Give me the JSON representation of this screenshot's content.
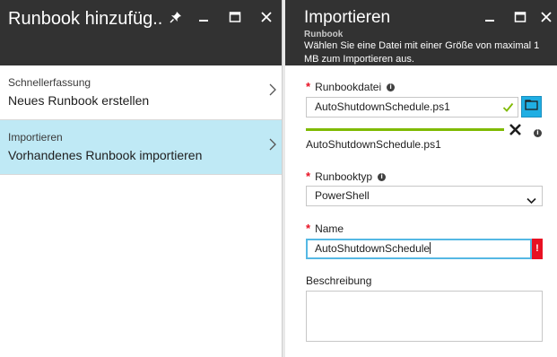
{
  "left_blade": {
    "title": "Runbook hinzufüg...",
    "items": [
      {
        "sublabel": "Schnellerfassung",
        "label": "Neues Runbook erstellen",
        "selected": false
      },
      {
        "sublabel": "Importieren",
        "label": "Vorhandenes Runbook importieren",
        "selected": true
      }
    ]
  },
  "right_blade": {
    "title": "Importieren",
    "subtitle": "Runbook",
    "description": "Wählen Sie eine Datei mit einer Größe von maximal 1 MB zum Importieren aus.",
    "file_field": {
      "label": "Runbookdatei",
      "value": "AutoShutdownSchedule.ps1",
      "upload_progress": 1.0,
      "uploaded_file_name": "AutoShutdownSchedule.ps1"
    },
    "type_field": {
      "label": "Runbooktyp",
      "value": "PowerShell"
    },
    "name_field": {
      "label": "Name",
      "value": "AutoShutdownSchedule",
      "error_marker": "!"
    },
    "description_field": {
      "label": "Beschreibung",
      "value": ""
    }
  },
  "required_marker": "*",
  "colors": {
    "header_bg": "#323232",
    "selected_item_bg": "#bfe9f5",
    "accent_blue": "#1faee3",
    "success_green": "#7fba00",
    "error_red": "#e81123"
  },
  "icons": [
    "pin-icon",
    "minimize-icon",
    "maximize-icon",
    "close-icon",
    "chevron-right-icon",
    "info-icon",
    "checkmark-icon",
    "folder-icon",
    "cancel-x-icon",
    "chevron-down-icon"
  ]
}
